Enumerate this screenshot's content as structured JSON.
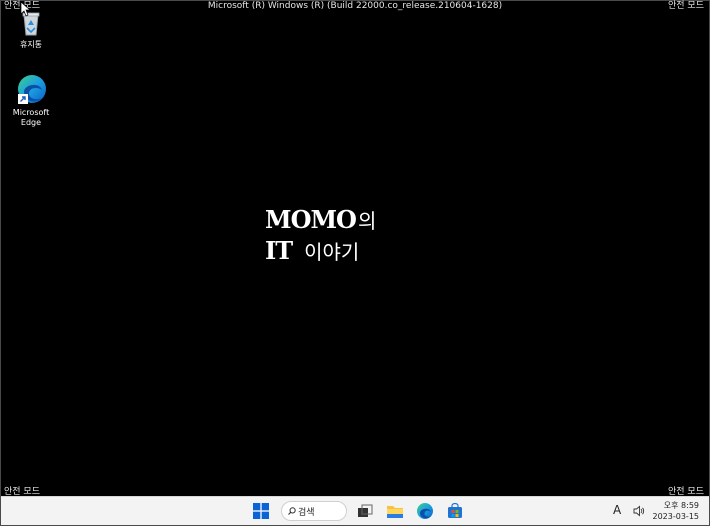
{
  "window_title": "Microsoft (R) Windows (R) (Build 22000.co_release.210604-1628)",
  "safe_mode_label": "안전 모드",
  "desktop_icons": [
    {
      "label": "휴지통"
    },
    {
      "label_line1": "Microsoft",
      "label_line2": "Edge"
    }
  ],
  "watermark": {
    "line1_latin": "MOMO",
    "line1_kor": "의",
    "line2_latin": "IT",
    "line2_kor": "이야기"
  },
  "taskbar": {
    "search_label": "검색",
    "pinned": [
      "start-icon",
      "search-icon",
      "task-view-icon",
      "file-explorer-icon",
      "edge-icon",
      "store-icon"
    ],
    "input_indicator": "A",
    "clock_time": "오후 8:59",
    "clock_date": "2023-03-15"
  },
  "colors": {
    "desktop_bg": "#000000",
    "taskbar_bg": "#f3f3f3",
    "accent_blue": "#0a64d8"
  }
}
